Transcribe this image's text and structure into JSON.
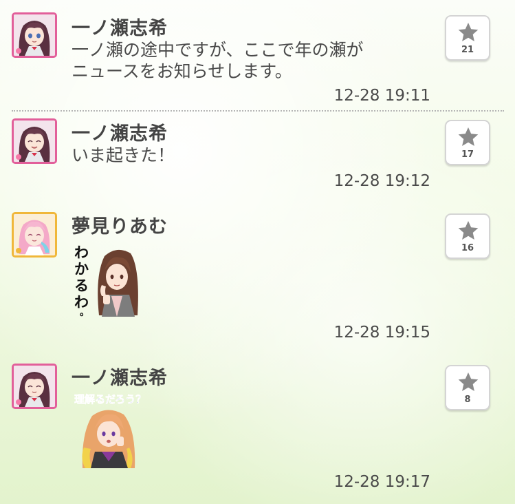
{
  "posts": [
    {
      "author": "一ノ瀬志希",
      "text_lines": [
        "一ノ瀬の途中ですが、ここで年の瀬が",
        "ニュースをお知らせします。"
      ],
      "time": "12-28 19:11",
      "star_count": "21",
      "avatar_icon": "shiki-avatar-icon",
      "avatar_color": "#e25f9a"
    },
    {
      "author": "一ノ瀬志希",
      "text_lines": [
        "いま起きた！"
      ],
      "time": "12-28 19:12",
      "star_count": "17",
      "avatar_icon": "shiki-avatar-icon",
      "avatar_color": "#e25f9a"
    },
    {
      "author": "夢見りあむ",
      "sticker_text": "わかるわ。",
      "time": "12-28 19:15",
      "star_count": "16",
      "avatar_icon": "riamu-avatar-icon",
      "avatar_color": "#f0b73a"
    },
    {
      "author": "一ノ瀬志希",
      "sticker_text": "理解るだろう？",
      "time": "12-28 19:17",
      "star_count": "8",
      "avatar_icon": "shiki-avatar-icon",
      "avatar_color": "#e25f9a"
    }
  ],
  "icons": {
    "star": "star-icon",
    "sticker_1": "character-sticker-brown-hair",
    "sticker_2": "character-sticker-orange-hair"
  }
}
